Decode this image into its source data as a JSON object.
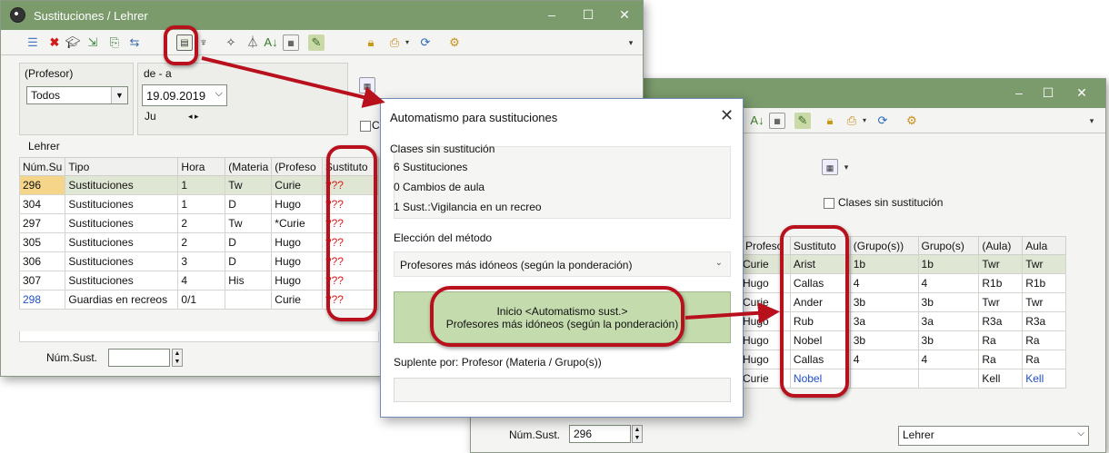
{
  "win1": {
    "title": "Sustituciones / Lehrer",
    "filter_label": "(Profesor)",
    "filter_value": "Todos",
    "date_label": "de - a",
    "date_value": "19.09.2019",
    "day_label": "Ju",
    "section_label": "Lehrer",
    "checkbox_partial": "Cl",
    "num_sust_label": "Núm.Sust.",
    "num_sust_value": "",
    "columns": [
      "Núm.Su",
      "Tipo",
      "Hora",
      "(Materia",
      "(Profeso",
      "Sustituto"
    ],
    "rows": [
      {
        "num": "296",
        "tipo": "Sustituciones",
        "hora": "1",
        "materia": "Tw",
        "profesor": "Curie",
        "sustituto": "???"
      },
      {
        "num": "304",
        "tipo": "Sustituciones",
        "hora": "1",
        "materia": "D",
        "profesor": "Hugo",
        "sustituto": "???"
      },
      {
        "num": "297",
        "tipo": "Sustituciones",
        "hora": "2",
        "materia": "Tw",
        "profesor": "*Curie",
        "sustituto": "???"
      },
      {
        "num": "305",
        "tipo": "Sustituciones",
        "hora": "2",
        "materia": "D",
        "profesor": "Hugo",
        "sustituto": "???"
      },
      {
        "num": "306",
        "tipo": "Sustituciones",
        "hora": "3",
        "materia": "D",
        "profesor": "Hugo",
        "sustituto": "???"
      },
      {
        "num": "307",
        "tipo": "Sustituciones",
        "hora": "4",
        "materia": "His",
        "profesor": "Hugo",
        "sustituto": "???"
      },
      {
        "num": "298",
        "tipo": "Guardias en recreos",
        "hora": "0/1",
        "materia": "",
        "profesor": "Curie",
        "sustituto": "???"
      }
    ]
  },
  "win2": {
    "checkbox_label": "Clases sin sustitución",
    "num_sust_label": "Núm.Sust.",
    "num_sust_value": "296",
    "bottom_select": "Lehrer",
    "columns": [
      "Profeso",
      "Sustituto",
      "(Grupo(s))",
      "Grupo(s)",
      "(Aula)",
      "Aula"
    ],
    "rows": [
      {
        "profesor": "Curie",
        "sustituto": "Arist",
        "grupo_old": "1b",
        "grupo": "1b",
        "aula_old": "Twr",
        "aula": "Twr"
      },
      {
        "profesor": "Hugo",
        "sustituto": "Callas",
        "grupo_old": "4",
        "grupo": "4",
        "aula_old": "R1b",
        "aula": "R1b"
      },
      {
        "profesor": "Curie",
        "sustituto": "Ander",
        "grupo_old": "3b",
        "grupo": "3b",
        "aula_old": "Twr",
        "aula": "Twr"
      },
      {
        "profesor": "Hugo",
        "sustituto": "Rub",
        "grupo_old": "3a",
        "grupo": "3a",
        "aula_old": "R3a",
        "aula": "R3a"
      },
      {
        "profesor": "Hugo",
        "sustituto": "Nobel",
        "grupo_old": "3b",
        "grupo": "3b",
        "aula_old": "Ra",
        "aula": "Ra"
      },
      {
        "profesor": "Hugo",
        "sustituto": "Callas",
        "grupo_old": "4",
        "grupo": "4",
        "aula_old": "Ra",
        "aula": "Ra"
      },
      {
        "profesor": "Curie",
        "sustituto": "Nobel",
        "grupo_old": "",
        "grupo": "",
        "aula_old": "Kell",
        "aula": "Kell"
      }
    ]
  },
  "dialog": {
    "title": "Automatismo para sustituciones",
    "group_title": "Clases sin sustitución",
    "stat1": "6 Sustituciones",
    "stat2": "0 Cambios de aula",
    "stat3": "1 Sust.:Vigilancia en un recreo",
    "method_label": "Elección del método",
    "method_value": "Profesores más idóneos (según la ponderación)",
    "start_line1": "Inicio <Automatismo sust.>",
    "start_line2": "Profesores más idóneos (según la ponderación)",
    "suplente_label": "Suplente por: Profesor (Materia / Grupo(s))",
    "suplente_value": ""
  },
  "colors": {
    "titlebar": "#7b9b6c",
    "highlight_oval": "#b8101c",
    "start_button": "#c4dbad",
    "missing_substitute": "#e01818",
    "link_blue": "#1f50c8"
  }
}
